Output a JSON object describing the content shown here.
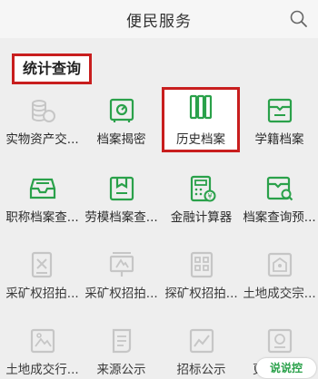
{
  "header": {
    "title": "便民服务",
    "search_icon": "search-icon"
  },
  "section": {
    "title": "统计查询"
  },
  "colors": {
    "accent": "#2aa14a",
    "highlight": "#c81e1e",
    "muted": "#c6c6c6"
  },
  "rows": [
    [
      {
        "label": "实物资产交...",
        "icon": "coins-icon"
      },
      {
        "label": "档案揭密",
        "icon": "safe-icon"
      },
      {
        "label": "历史档案",
        "icon": "binders-icon"
      },
      {
        "label": "学籍档案",
        "icon": "student-folder-icon"
      }
    ],
    [
      {
        "label": "职称档案查...",
        "icon": "inbox-tray-icon"
      },
      {
        "label": "劳模档案查...",
        "icon": "badge-folder-icon"
      },
      {
        "label": "金融计算器",
        "icon": "calculator-icon"
      },
      {
        "label": "档案查询预...",
        "icon": "folder-search-icon"
      }
    ],
    [
      {
        "label": "采矿权招拍...",
        "icon": "mining-icon"
      },
      {
        "label": "采矿权招拍...",
        "icon": "mining-sign-icon"
      },
      {
        "label": "探矿权招拍...",
        "icon": "exploration-icon"
      },
      {
        "label": "土地成交宗...",
        "icon": "land-deal-icon"
      }
    ],
    [
      {
        "label": "土地成交行...",
        "icon": "land-map-icon"
      },
      {
        "label": "来源公示",
        "icon": "scroll-icon"
      },
      {
        "label": "招标公示",
        "icon": "chart-line-icon"
      },
      {
        "label": "更多",
        "icon": "more-icon"
      }
    ]
  ],
  "watermark": {
    "text": "说说控"
  }
}
